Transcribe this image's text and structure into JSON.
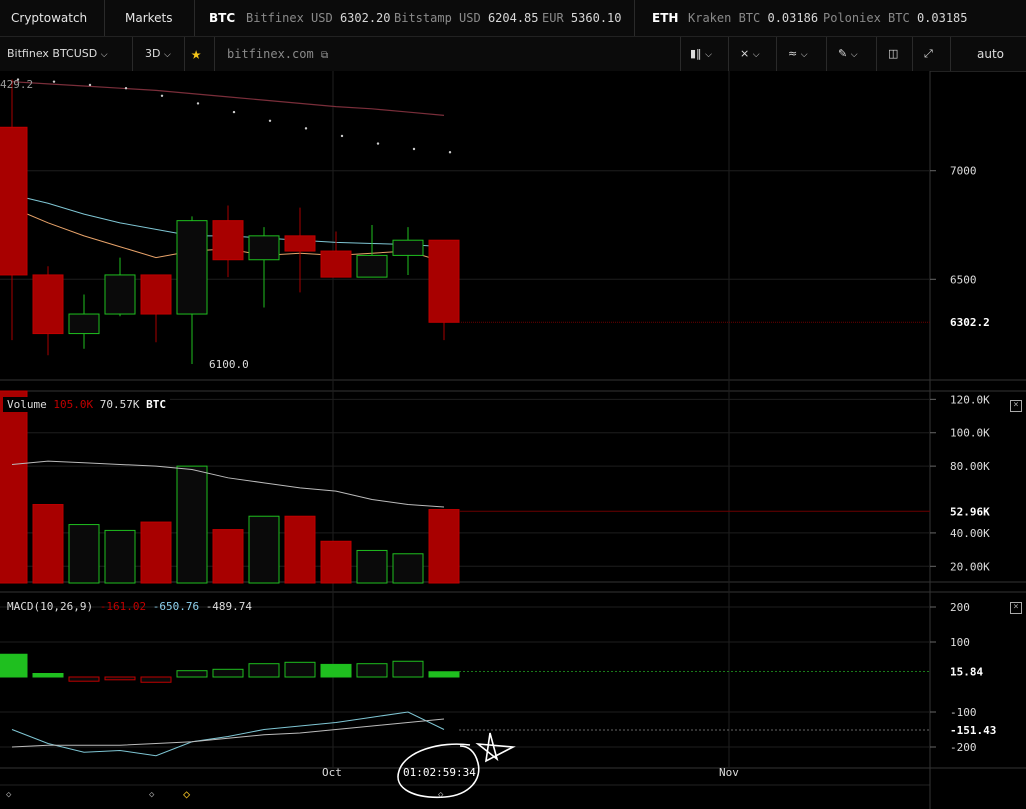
{
  "header": {
    "brand": "Cryptowatch",
    "markets": "Markets",
    "btc": {
      "label": "BTC",
      "quotes": [
        {
          "exchange": "Bitfinex USD",
          "price": "6302.20"
        },
        {
          "exchange": "Bitstamp USD",
          "price": "6204.85"
        },
        {
          "exchange": "EUR",
          "price": "5360.10"
        }
      ]
    },
    "eth": {
      "label": "ETH",
      "quotes": [
        {
          "exchange": "Kraken BTC",
          "price": "0.03186"
        },
        {
          "exchange": "Poloniex BTC",
          "price": "0.03185"
        }
      ]
    }
  },
  "toolbar": {
    "market": "Bitfinex BTCUSD",
    "period": "3D",
    "site": "bitfinex.com",
    "scale": "auto"
  },
  "chart_data": [
    {
      "type": "candlestick",
      "name": "Price",
      "ylim": [
        6050,
        7450
      ],
      "yticks": [
        "7000",
        "6500"
      ],
      "last_price": "6302.2",
      "top_label": "429.2",
      "low_label": "6100.0",
      "candles": [
        {
          "o": 7200,
          "h": 7420,
          "l": 6220,
          "c": 6520
        },
        {
          "o": 6520,
          "h": 6560,
          "l": 6150,
          "c": 6250
        },
        {
          "o": 6250,
          "h": 6430,
          "l": 6180,
          "c": 6340
        },
        {
          "o": 6340,
          "h": 6600,
          "l": 6330,
          "c": 6520
        },
        {
          "o": 6520,
          "h": 6520,
          "l": 6210,
          "c": 6340
        },
        {
          "o": 6340,
          "h": 6790,
          "l": 6110,
          "c": 6770
        },
        {
          "o": 6770,
          "h": 6840,
          "l": 6510,
          "c": 6590
        },
        {
          "o": 6590,
          "h": 6740,
          "l": 6370,
          "c": 6700
        },
        {
          "o": 6700,
          "h": 6830,
          "l": 6440,
          "c": 6630
        },
        {
          "o": 6630,
          "h": 6720,
          "l": 6510,
          "c": 6510
        },
        {
          "o": 6510,
          "h": 6750,
          "l": 6510,
          "c": 6610
        },
        {
          "o": 6610,
          "h": 6740,
          "l": 6520,
          "c": 6680
        },
        {
          "o": 6680,
          "h": 6680,
          "l": 6220,
          "c": 6302
        }
      ],
      "ma_long": [
        7410,
        7400,
        7390,
        7380,
        7370,
        7355,
        7340,
        7325,
        7310,
        7295,
        7285,
        7270,
        7255
      ],
      "ma_mid": [
        6890,
        6850,
        6800,
        6760,
        6730,
        6700,
        6700,
        6690,
        6680,
        6670,
        6665,
        6660,
        6650
      ],
      "ma_short": [
        6830,
        6760,
        6700,
        6650,
        6600,
        6630,
        6640,
        6610,
        6620,
        6610,
        6620,
        6630,
        6580
      ],
      "sar": [
        7420,
        7410,
        7395,
        7380,
        7345,
        7310,
        7270,
        7230,
        7195,
        7160,
        7125,
        7100,
        7085
      ]
    },
    {
      "type": "bar",
      "name": "Volume",
      "legend": {
        "label": "Volume",
        "v1": "105.0K",
        "v2": "70.57K",
        "unit": "BTC"
      },
      "ylim": [
        10000,
        125000
      ],
      "yticks": [
        "120.0K",
        "100.0K",
        "80.00K",
        "40.00K",
        "20.00K"
      ],
      "last_value": "52.96K",
      "values": [
        130000,
        57000,
        45000,
        41500,
        46500,
        80000,
        42000,
        50000,
        50000,
        35000,
        29500,
        27500,
        54000
      ],
      "up": [
        false,
        false,
        true,
        true,
        false,
        true,
        false,
        true,
        false,
        false,
        true,
        true,
        false
      ],
      "ma": [
        81000,
        83000,
        82000,
        81000,
        80000,
        78000,
        73000,
        70000,
        67000,
        65000,
        60000,
        57000,
        55500
      ]
    },
    {
      "type": "bar",
      "name": "MACD",
      "legend": {
        "label": "MACD(10,26,9)",
        "v1": "-161.02",
        "v2": "-650.76",
        "v3": "-489.74"
      },
      "ylim": [
        -260,
        240
      ],
      "yticks": [
        "200",
        "100",
        "-100",
        "-200"
      ],
      "last_hist": "15.84",
      "last_line": "-151.43",
      "hist": [
        65,
        10,
        -12,
        -8,
        -15,
        18,
        22,
        38,
        42,
        36,
        38,
        45,
        15
      ],
      "macd_line": [
        -150,
        -190,
        -215,
        -210,
        -225,
        -185,
        -170,
        -150,
        -140,
        -130,
        -115,
        -100,
        -150
      ],
      "signal_line": [
        -200,
        -195,
        -195,
        -195,
        -190,
        -185,
        -175,
        -165,
        -160,
        -150,
        -140,
        -130,
        -120
      ]
    }
  ],
  "x_axis": {
    "oct": "Oct",
    "nov": "Nov"
  },
  "timer": "01:02:59:34"
}
